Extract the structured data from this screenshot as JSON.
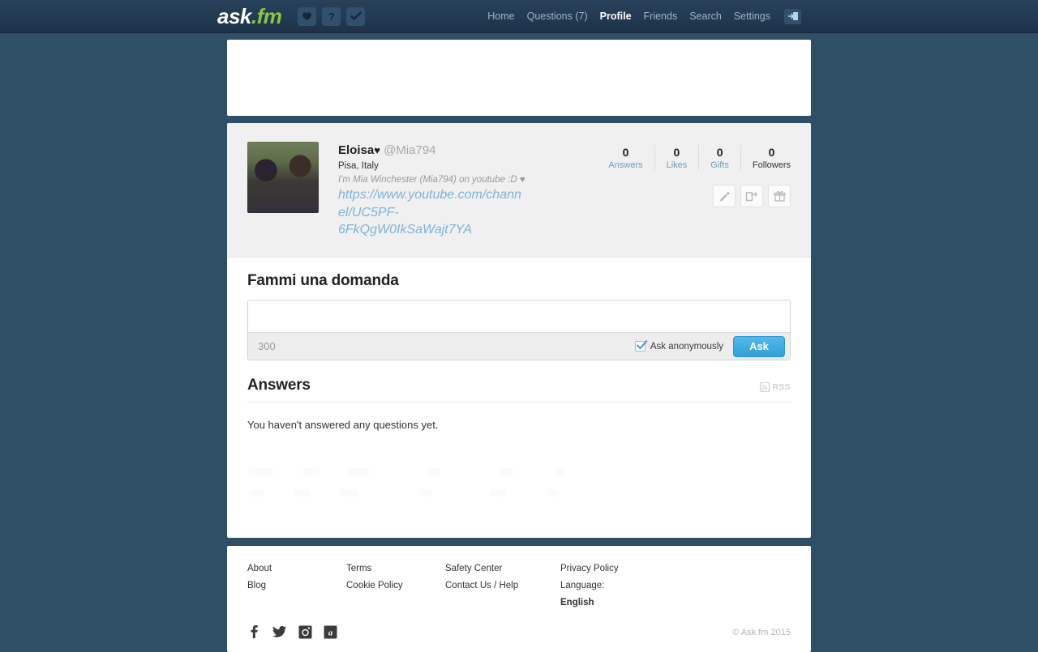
{
  "header": {
    "logo_text": "ask",
    "logo_dot": ".",
    "logo_fm": "fm",
    "icons": [
      {
        "name": "heart-icon",
        "label": "Heart"
      },
      {
        "name": "question-mark-icon",
        "label": "?"
      },
      {
        "name": "check-icon",
        "label": "Check"
      }
    ],
    "nav": [
      {
        "label": "Home",
        "active": false
      },
      {
        "label": "Questions (7)",
        "active": false
      },
      {
        "label": "Profile",
        "active": true
      },
      {
        "label": "Friends",
        "active": false
      },
      {
        "label": "Search",
        "active": false
      },
      {
        "label": "Settings",
        "active": false
      }
    ],
    "logout_icon": "logout-icon"
  },
  "profile": {
    "name": "Eloisa",
    "name_heart": "♥",
    "handle": "@Mia794",
    "location": "Pisa, Italy",
    "bio": "I'm Mia Winchester (Mia794) on youtube :D ♥",
    "bio_link": "https://www.youtube.com/channel/UC5PF-6FkQgW0IkSaWajt7YA",
    "stats": [
      {
        "value": "0",
        "label": "Answers",
        "is_link": true
      },
      {
        "value": "0",
        "label": "Likes",
        "is_link": true
      },
      {
        "value": "0",
        "label": "Gifts",
        "is_link": true
      },
      {
        "value": "0",
        "label": "Followers",
        "is_link": false
      }
    ],
    "actions": [
      {
        "name": "edit-pencil-icon",
        "title": "Edit profile"
      },
      {
        "name": "share-icon",
        "title": "Share"
      },
      {
        "name": "gift-icon",
        "title": "Send gift"
      }
    ]
  },
  "ask": {
    "title": "Fammi una domanda",
    "textarea_value": "",
    "textarea_placeholder": "",
    "char_count": "300",
    "anonymous_label": "Ask anonymously",
    "anonymous_checked": true,
    "submit_label": "Ask"
  },
  "answers": {
    "title": "Answers",
    "rss_label": "RSS",
    "empty_message": "You haven't answered any questions yet."
  },
  "footer": {
    "columns": [
      {
        "links": [
          "About",
          "Blog"
        ]
      },
      {
        "links": [
          "Terms",
          "Cookie Policy"
        ]
      },
      {
        "links": [
          "Safety Center",
          "Contact Us / Help"
        ]
      },
      {
        "links": [
          "Privacy Policy"
        ]
      }
    ],
    "language_prefix": "Language:",
    "language_value": "English",
    "social": [
      {
        "name": "facebook-icon",
        "label": "f"
      },
      {
        "name": "twitter-icon",
        "label": "t"
      },
      {
        "name": "instagram-icon",
        "label": "i"
      },
      {
        "name": "askfm-icon",
        "label": "a"
      }
    ],
    "copyright": "© Ask.fm 2015"
  },
  "colors": {
    "page_bg": "#2e4f66",
    "header_bg": "#223a52",
    "accent_blue": "#30a2dc",
    "link_blue": "#6a9fc4",
    "logo_green": "#8dc63f"
  }
}
